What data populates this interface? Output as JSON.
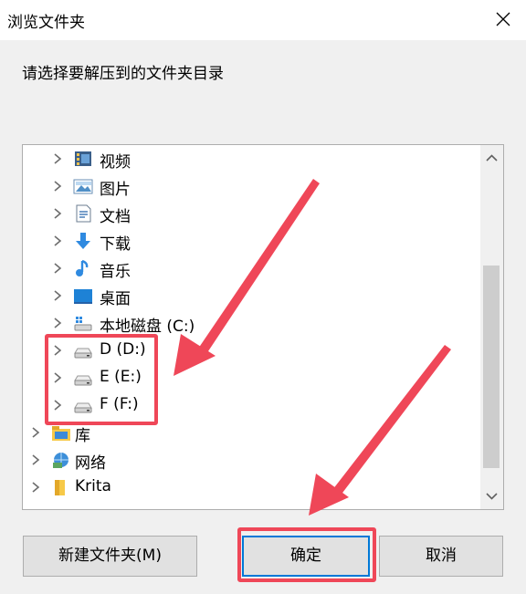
{
  "dialog": {
    "title": "浏览文件夹",
    "prompt": "请选择要解压到的文件夹目录"
  },
  "tree": {
    "items": [
      {
        "label": "视频",
        "icon": "video-folder-icon"
      },
      {
        "label": "图片",
        "icon": "pictures-folder-icon"
      },
      {
        "label": "文档",
        "icon": "documents-folder-icon"
      },
      {
        "label": "下载",
        "icon": "downloads-folder-icon"
      },
      {
        "label": "音乐",
        "icon": "music-folder-icon"
      },
      {
        "label": "桌面",
        "icon": "desktop-folder-icon"
      },
      {
        "label": "本地磁盘 (C:)",
        "icon": "system-drive-icon"
      },
      {
        "label": "D (D:)",
        "icon": "drive-icon"
      },
      {
        "label": "E (E:)",
        "icon": "drive-icon"
      },
      {
        "label": "F (F:)",
        "icon": "drive-icon"
      },
      {
        "label": "库",
        "icon": "libraries-icon"
      },
      {
        "label": "网络",
        "icon": "network-icon"
      },
      {
        "label": "Krita",
        "icon": "folder-icon"
      }
    ]
  },
  "buttons": {
    "new_folder": "新建文件夹(M)",
    "ok": "确定",
    "cancel": "取消"
  },
  "colors": {
    "annotation": "#ef4758",
    "focus_border": "#0078d7"
  }
}
